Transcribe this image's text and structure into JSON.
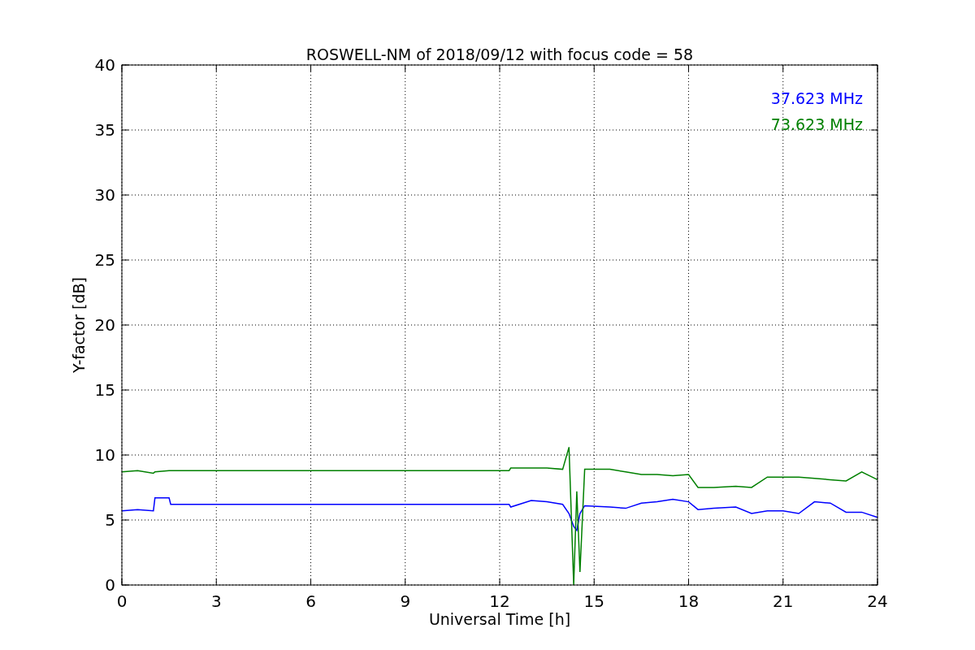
{
  "chart_data": {
    "type": "line",
    "title": "ROSWELL-NM of 2018/09/12 with focus code = 58",
    "xlabel": "Universal Time [h]",
    "ylabel": "Y-factor [dB]",
    "x": [
      0,
      0.5,
      1,
      1.05,
      1.5,
      1.55,
      12.3,
      12.35,
      13,
      13.5,
      14,
      14.2,
      14.35,
      14.45,
      14.55,
      14.7,
      15.5,
      16,
      16.5,
      17,
      17.5,
      18,
      18.3,
      18.8,
      19.5,
      20,
      20.5,
      21,
      21.5,
      22,
      22.5,
      23,
      23.5,
      24
    ],
    "series": [
      {
        "name": "37.623 MHz",
        "color": "#0000ff",
        "values": [
          5.7,
          5.8,
          5.7,
          6.7,
          6.7,
          6.2,
          6.2,
          6.0,
          6.5,
          6.4,
          6.2,
          5.5,
          4.5,
          4.2,
          5.5,
          6.1,
          6.0,
          5.9,
          6.3,
          6.4,
          6.6,
          6.4,
          5.8,
          5.9,
          6.0,
          5.5,
          5.7,
          5.7,
          5.5,
          6.4,
          6.3,
          5.6,
          5.6,
          5.2
        ]
      },
      {
        "name": "73.623 MHz",
        "color": "#008000",
        "values": [
          8.7,
          8.8,
          8.6,
          8.7,
          8.8,
          8.8,
          8.8,
          9.0,
          9.0,
          9.0,
          8.9,
          10.6,
          0.0,
          7.2,
          1.0,
          8.9,
          8.9,
          8.7,
          8.5,
          8.5,
          8.4,
          8.5,
          7.5,
          7.5,
          7.6,
          7.5,
          8.3,
          8.3,
          8.3,
          8.2,
          8.1,
          8.0,
          8.7,
          8.1
        ]
      }
    ],
    "xlim": [
      0,
      24
    ],
    "ylim": [
      0,
      40
    ],
    "xticks": [
      0,
      3,
      6,
      9,
      12,
      15,
      18,
      21,
      24
    ],
    "yticks": [
      0,
      5,
      10,
      15,
      20,
      25,
      30,
      35,
      40
    ],
    "grid": true
  }
}
